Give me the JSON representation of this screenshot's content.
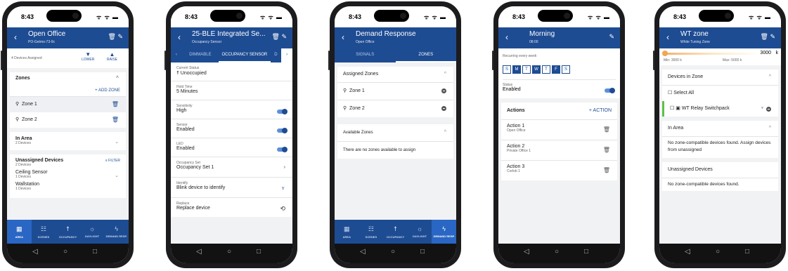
{
  "status": {
    "time": "8:43",
    "icons": "ᯤ ᯤ ▬"
  },
  "colors": {
    "header": "#1e4c93",
    "accent": "#1e4c93",
    "toggle": "#5d8fd9"
  },
  "phone1": {
    "title": "Open Office",
    "subtitle": "PO-Getmo-73-9c",
    "devices_assigned": "4 Devices Assigned",
    "lower": "LOWER",
    "raise": "RAISE",
    "zones_title": "Zones",
    "add_zone": "+ ADD ZONE",
    "zones": [
      "Zone 1",
      "Zone 2"
    ],
    "in_area": "In Area",
    "in_area_count": "2 Devices",
    "unassigned_title": "Unassigned Devices",
    "unassigned_count": "2 Devices",
    "filter": "FILTER",
    "devices": [
      {
        "name": "Ceiling Sensor",
        "count": "1 Devices"
      },
      {
        "name": "Wallstation",
        "count": "1 Devices"
      }
    ],
    "nav": [
      "AREA",
      "SCENES",
      "OCCUPANCY",
      "DAYLIGHT",
      "DEMAND RESP."
    ]
  },
  "phone2": {
    "title": "25-BLE Integrated Se...",
    "subtitle": "Occupancy Sensor",
    "tabs": [
      "DIMMABLE",
      "OCCUPANCY SENSOR",
      "D"
    ],
    "fields": [
      {
        "label": "Current Status",
        "value": "Unoccupied"
      },
      {
        "label": "Hold Time",
        "value": "5 Minutes"
      },
      {
        "label": "Sensitivity",
        "value": "High"
      },
      {
        "label": "Sensor",
        "value": "Enabled"
      },
      {
        "label": "LED",
        "value": "Enabled"
      },
      {
        "label": "Occupancy Set",
        "value": "Occupancy Set 1"
      },
      {
        "label": "Identify",
        "value": "Blink device to identify"
      },
      {
        "label": "Replace",
        "value": "Replace device"
      }
    ]
  },
  "phone3": {
    "title": "Demand Response",
    "subtitle": "Open Office",
    "tabs": [
      "SIGNALS",
      "ZONES"
    ],
    "assigned_title": "Assigned Zones",
    "zones": [
      "Zone 1",
      "Zone 2"
    ],
    "available_title": "Available Zones",
    "no_zones": "There are no zones available to assign",
    "nav": [
      "AREA",
      "SCENES",
      "OCCUPANCY",
      "DAYLIGHT",
      "DEMAND RESP."
    ]
  },
  "phone4": {
    "title": "Morning",
    "subtitle": "08:00",
    "recurring": "Recurring every week",
    "days": [
      {
        "d": "S",
        "on": false
      },
      {
        "d": "M",
        "on": true
      },
      {
        "d": "T",
        "on": false
      },
      {
        "d": "W",
        "on": true
      },
      {
        "d": "T",
        "on": false
      },
      {
        "d": "F",
        "on": true
      },
      {
        "d": "S",
        "on": false
      }
    ],
    "status_label": "Status",
    "status_value": "Enabled",
    "actions_title": "Actions",
    "add_action": "+ ACTION",
    "actions": [
      {
        "name": "Action 1",
        "sub": "Open Office"
      },
      {
        "name": "Action 2",
        "sub": "Private Office 1"
      },
      {
        "name": "Action 3",
        "sub": "Corlob 1"
      }
    ]
  },
  "phone5": {
    "title": "WT zone",
    "subtitle": "White Tuning Zone",
    "cct_value": "3000",
    "cct_unit": "k",
    "min": "Min: 3000 k",
    "max": "Max: 5000 k",
    "devices_title": "Devices in Zone",
    "select_all": "Select All",
    "device": "WT Relay Switchpack",
    "in_area": "In Area",
    "in_area_text": "No zone-compatible devices found. Assign devices from unassigned",
    "unassigned": "Unassigned Devices",
    "unassigned_text": "No zone-compatible devices found."
  }
}
